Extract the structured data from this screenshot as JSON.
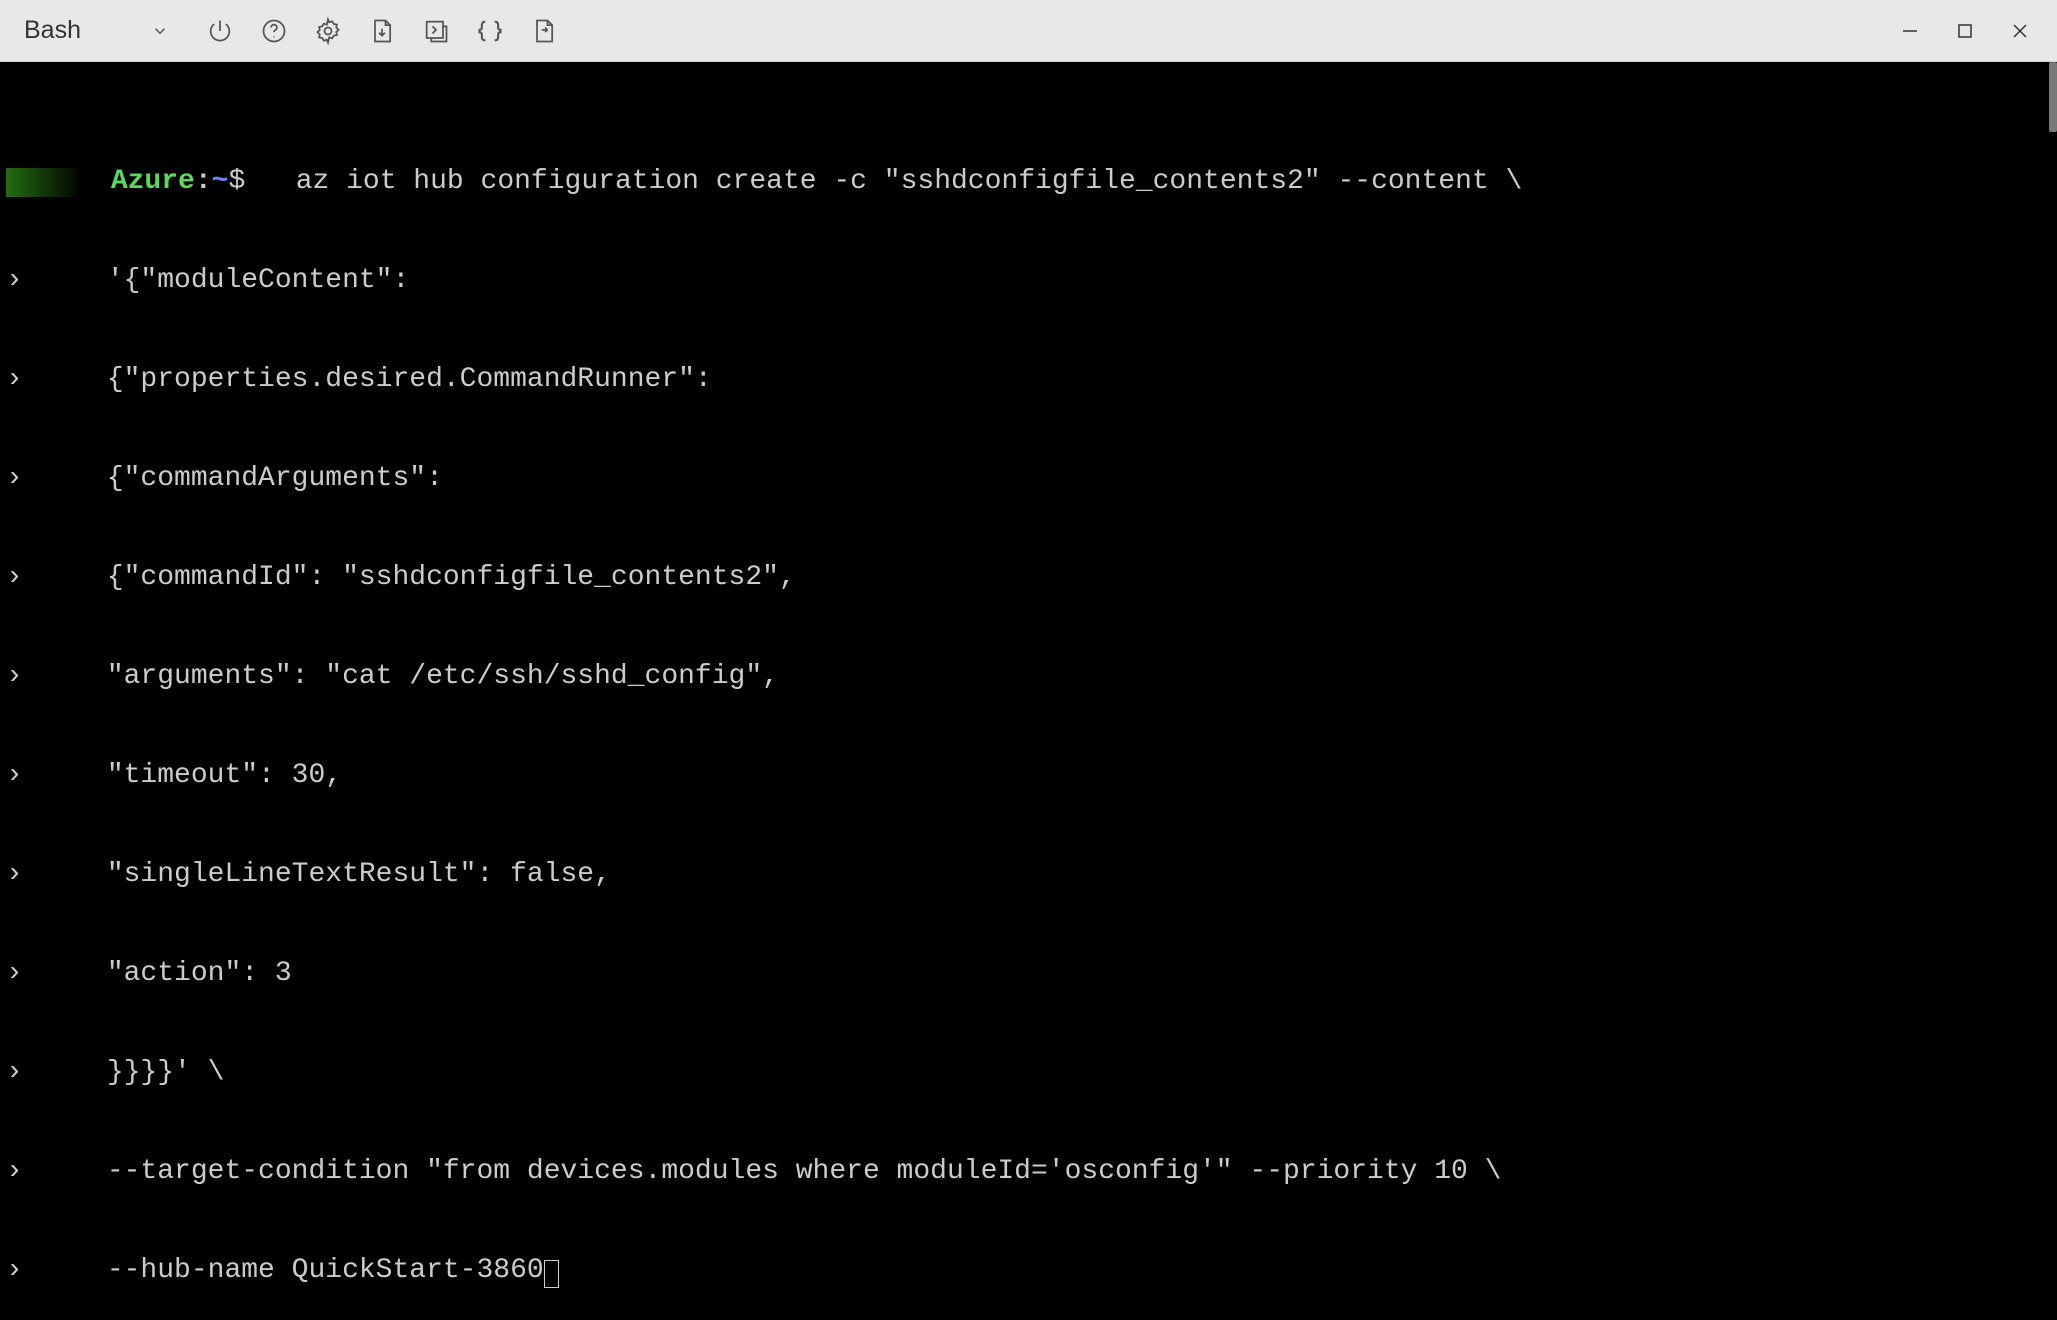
{
  "toolbar": {
    "shell_label": "Bash",
    "icons": {
      "power": "power-icon",
      "help": "help-icon",
      "settings": "settings-icon",
      "new_file": "new-file-icon",
      "upload": "upload-icon",
      "braces": "braces-icon",
      "open_editor": "open-editor-icon"
    },
    "window": {
      "minimize": "minimize",
      "maximize": "maximize",
      "close": "close"
    }
  },
  "terminal": {
    "prompt": {
      "user_obscured": "      ",
      "host": "Azure",
      "colon": ":",
      "path": "~",
      "dollar": "$"
    },
    "continuation": "›",
    "first_line": "   az iot hub configuration create -c \"sshdconfigfile_contents2\" --content \\",
    "lines": [
      "     '{\"moduleContent\":",
      "     {\"properties.desired.CommandRunner\":",
      "     {\"commandArguments\":",
      "     {\"commandId\": \"sshdconfigfile_contents2\",",
      "     \"arguments\": \"cat /etc/ssh/sshd_config\",",
      "     \"timeout\": 30,",
      "     \"singleLineTextResult\": false,",
      "     \"action\": 3",
      "     }}}}' \\",
      "     --target-condition \"from devices.modules where moduleId='osconfig'\" --priority 10 \\",
      "     --hub-name QuickStart-3860"
    ]
  }
}
